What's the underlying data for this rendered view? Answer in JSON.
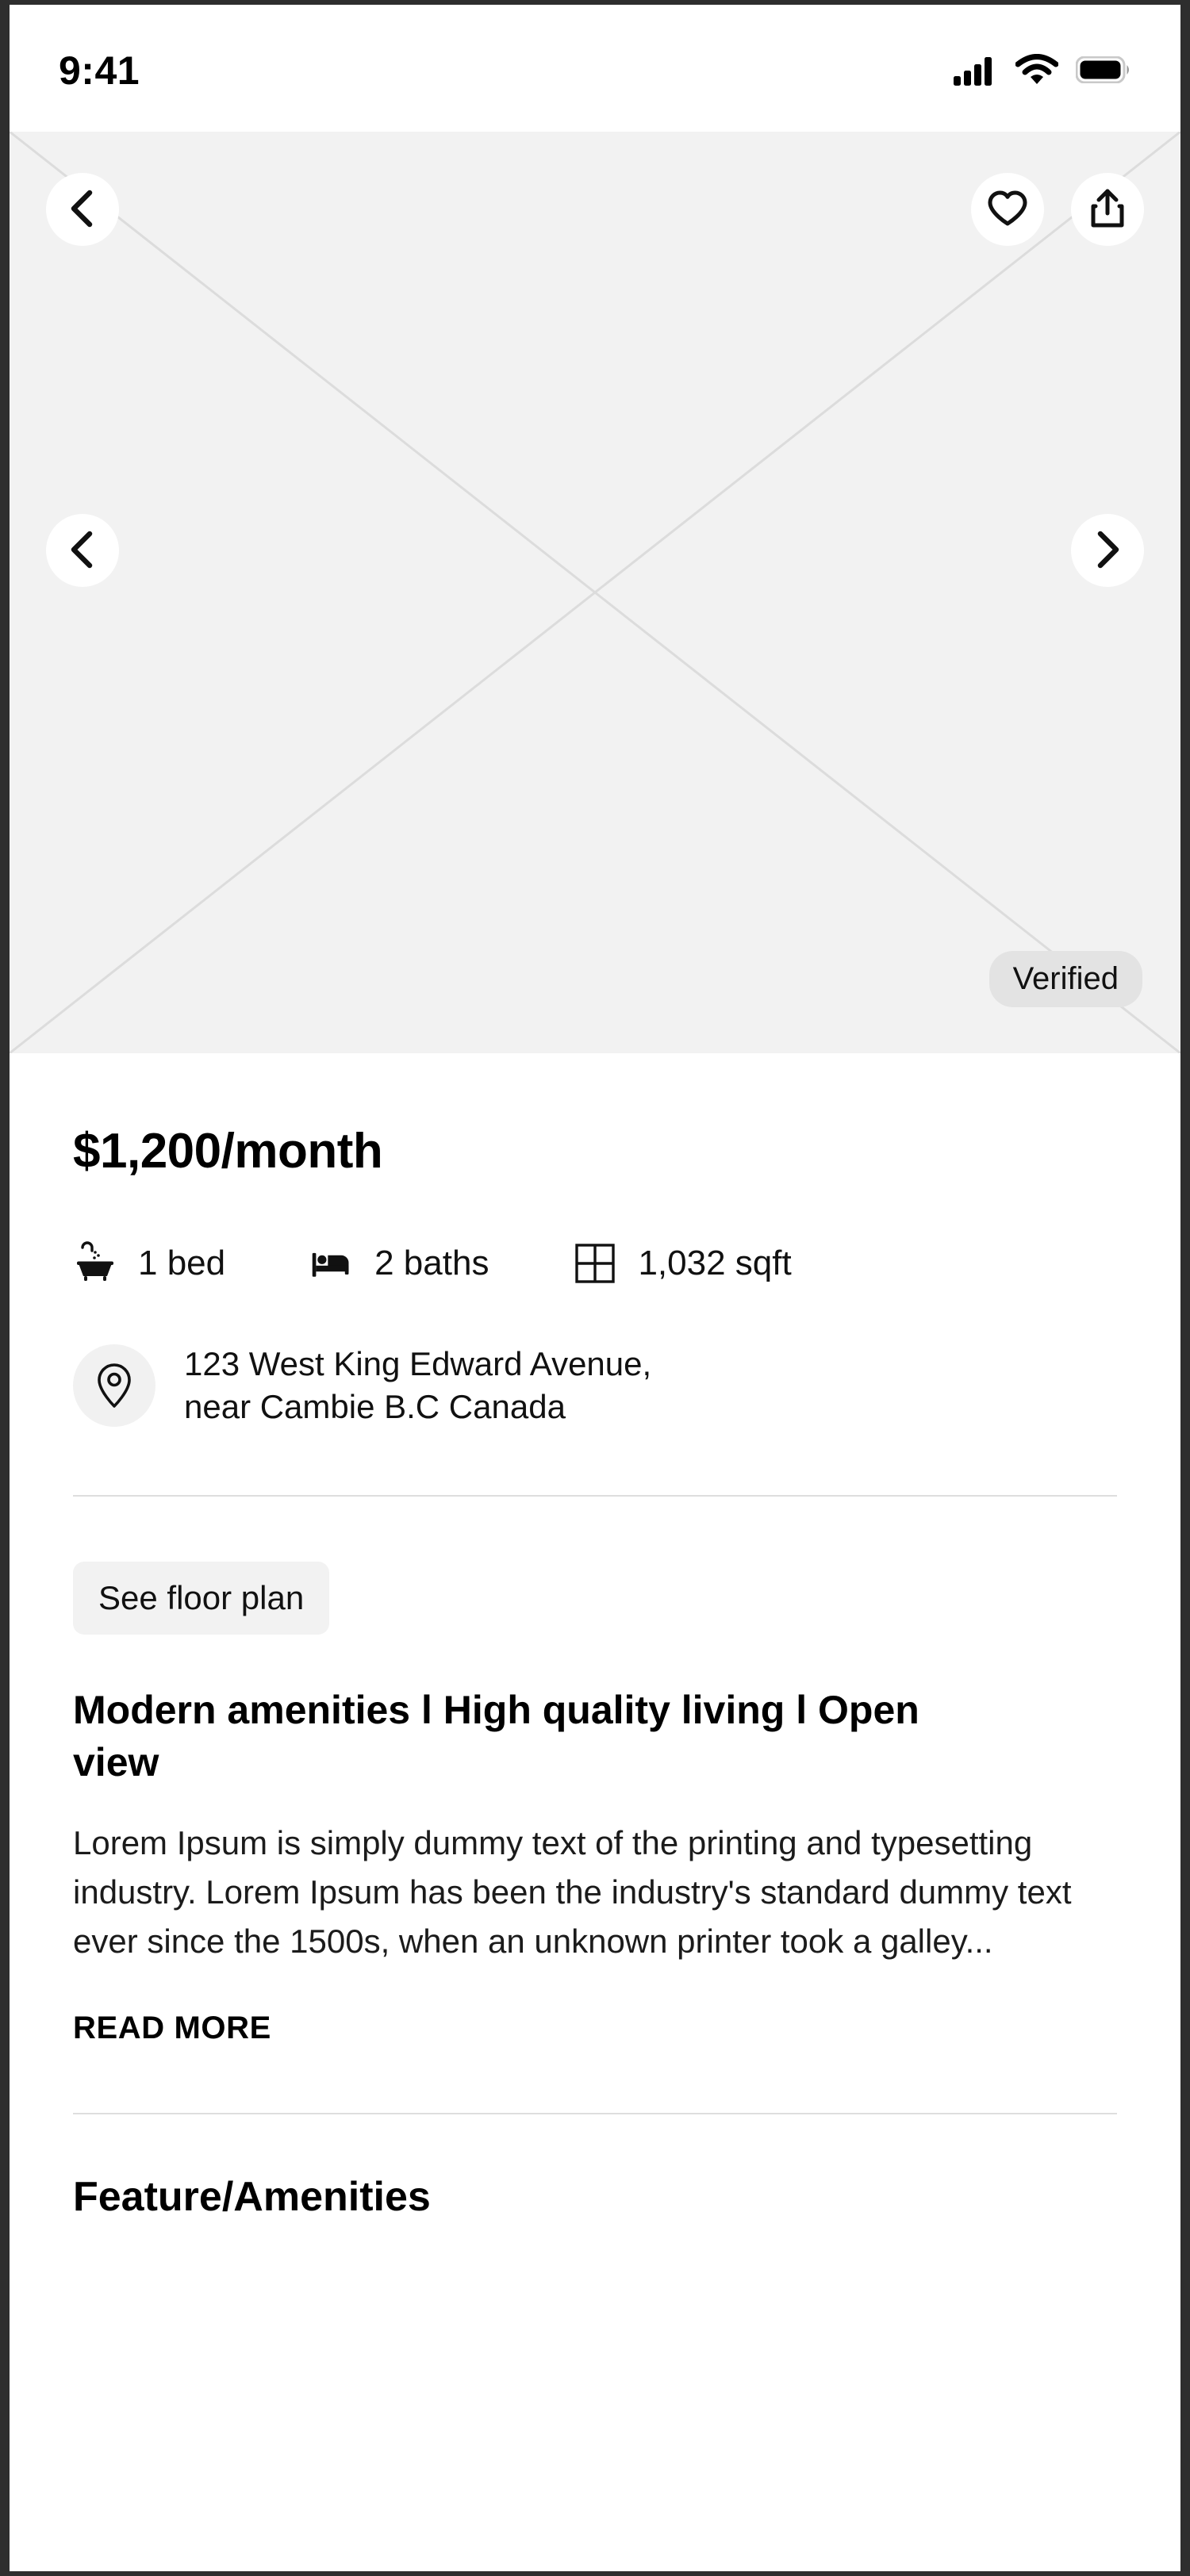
{
  "status_bar": {
    "time": "9:41",
    "icons": [
      "cellular-signal-icon",
      "wifi-icon",
      "battery-icon"
    ]
  },
  "gallery": {
    "back_icon": "chevron-left-icon",
    "favorite_icon": "heart-icon",
    "share_icon": "share-icon",
    "prev_icon": "chevron-left-icon",
    "next_icon": "chevron-right-icon",
    "badge_label": "Verified",
    "placeholder": "image-placeholder",
    "background_color": "#f2f2f2"
  },
  "listing": {
    "price": "$1,200/month",
    "specs": [
      {
        "icon": "bathtub-icon",
        "label": "1 bed"
      },
      {
        "icon": "bed-icon",
        "label": "2 baths"
      },
      {
        "icon": "area-grid-icon",
        "label": "1,032 sqft"
      }
    ],
    "address": {
      "icon": "location-pin-icon",
      "line1": "123 West King Edward Avenue,",
      "line2": "near Cambie B.C Canada"
    },
    "floor_plan_label": "See floor plan",
    "description_title": "Modern amenities l High quality living l Open view",
    "description_body": "Lorem Ipsum is simply dummy text of the printing and typesetting industry. Lorem Ipsum has been the industry's standard dummy text ever since the 1500s, when an unknown printer took a galley...",
    "read_more_label": "READ MORE",
    "amenities_section_title": "Feature/Amenities"
  },
  "colors": {
    "page_background": "#ffffff",
    "frame": "#2e2e2e",
    "surface_muted": "#f2f2f2",
    "badge": "#e3e3e3",
    "divider": "#dedede",
    "text_primary": "#000000"
  }
}
